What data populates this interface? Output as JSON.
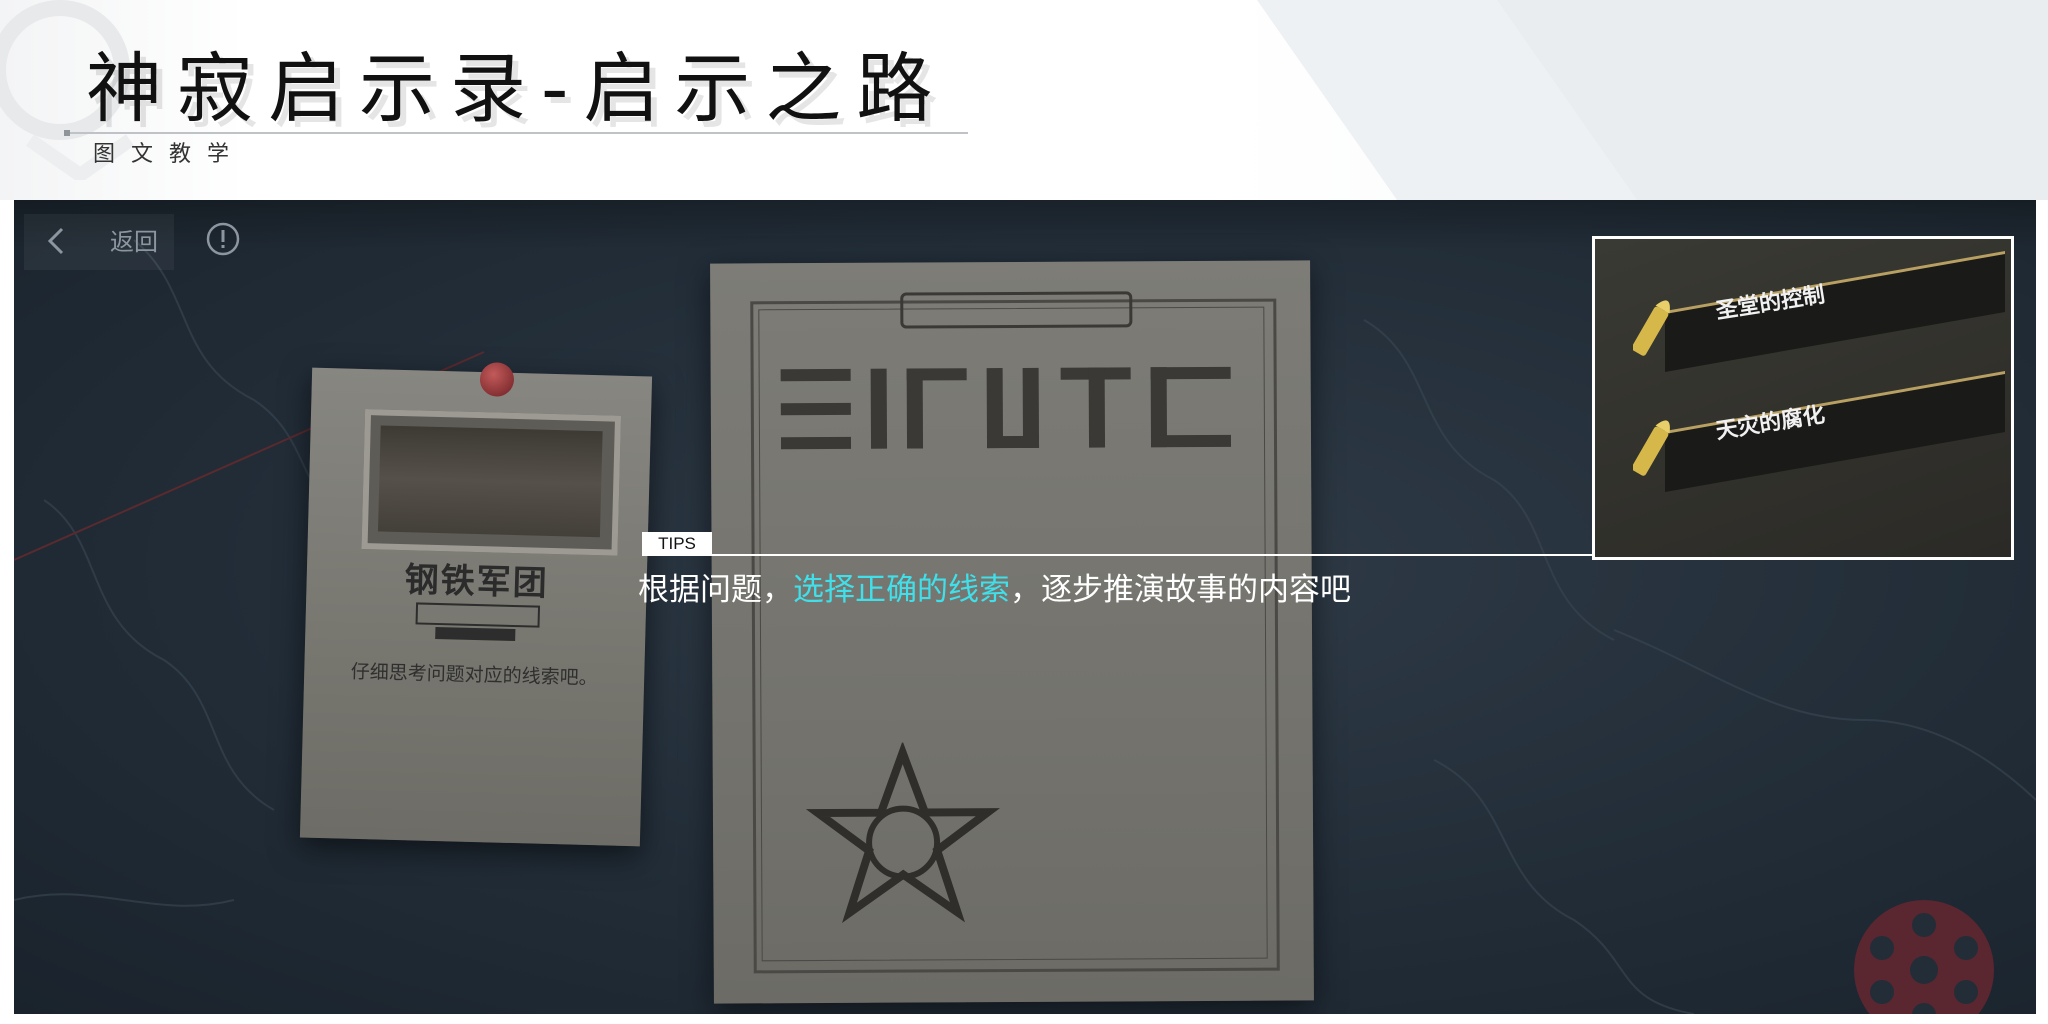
{
  "header": {
    "title": "神寂启示录-启示之路",
    "subtitle": "图文教学"
  },
  "game": {
    "back_label": "返回",
    "note": {
      "logo_text": "钢铁军团",
      "hint_text": "仔细思考问题对应的线索吧。"
    },
    "clues": [
      {
        "label": "圣堂的控制"
      },
      {
        "label": "天灾的腐化"
      }
    ],
    "tips": {
      "tag": "TIPS",
      "text_before": "根据问题，",
      "text_highlight": "选择正确的线索",
      "text_after": "，逐步推演故事的内容吧"
    }
  },
  "colors": {
    "highlight": "#3fe0ea",
    "panel_bg": "#222d38"
  },
  "icons": [
    "back-arrow-icon",
    "info-icon",
    "pin-icon",
    "bullet-icon",
    "sheriff-badge-icon",
    "gear-icon"
  ]
}
